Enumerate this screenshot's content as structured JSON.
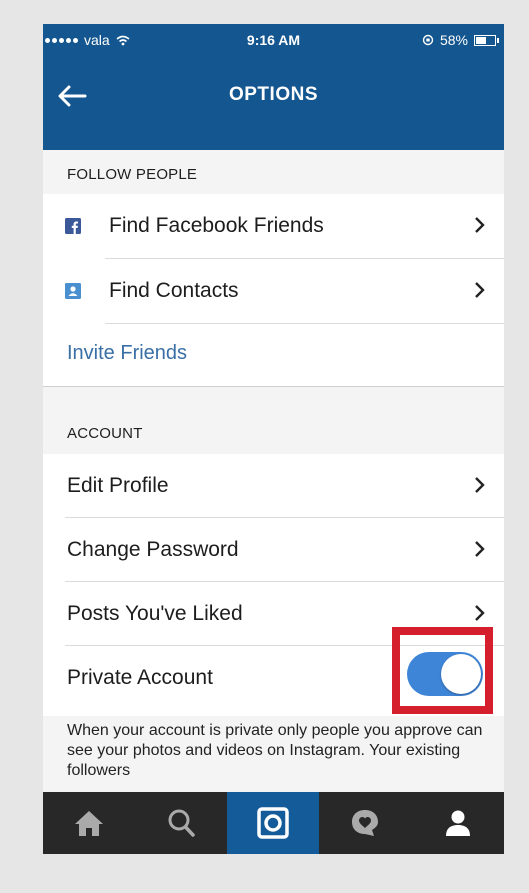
{
  "status_bar": {
    "carrier": "vala",
    "time": "9:16 AM",
    "battery": "58%",
    "battery_level": 0.58
  },
  "nav": {
    "title": "OPTIONS",
    "back_icon": "back-arrow-icon"
  },
  "follow_section": {
    "header": "FOLLOW PEOPLE",
    "items": [
      {
        "label": "Find Facebook Friends",
        "icon": "facebook-icon"
      },
      {
        "label": "Find Contacts",
        "icon": "contacts-icon"
      }
    ],
    "invite_label": "Invite Friends"
  },
  "account_section": {
    "header": "ACCOUNT",
    "items": [
      {
        "label": "Edit Profile"
      },
      {
        "label": "Change Password"
      },
      {
        "label": "Posts You've Liked"
      }
    ],
    "private_account": {
      "label": "Private Account",
      "enabled": true
    },
    "note": "When your account is private only people you approve can see your photos and videos on Instagram. Your existing followers"
  },
  "tab_bar": {
    "tabs": [
      "home-icon",
      "search-icon",
      "camera-icon",
      "activity-icon",
      "profile-icon"
    ],
    "active": "camera-icon"
  },
  "colors": {
    "header_blue": "#14568f",
    "toggle_blue": "#3f85d7",
    "highlight_red": "#d51f2c",
    "link_blue": "#3a6fa6"
  }
}
